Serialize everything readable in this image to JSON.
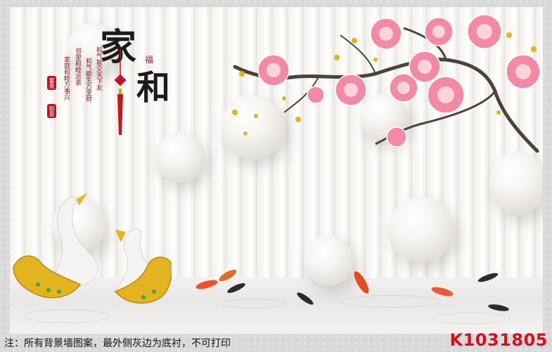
{
  "calligraphy": {
    "jia": "家",
    "he": "和",
    "fu": "福",
    "poem_lines": [
      "和气能交天下友",
      "和气能生万里财",
      "邻里和睦远亲",
      "家庭和睦万事兴"
    ],
    "seal_top": "富贵",
    "seal_bottom": "如意"
  },
  "caption": "注：所有背景墙图案，最外侧灰边为底衬，不可打印",
  "product_code": "K1031805",
  "icons": [
    "swan-icon",
    "koi-fish-icon",
    "magnolia-flower-icon",
    "chinese-knot-icon"
  ],
  "colors": {
    "background_stripe": "#f3f1ee",
    "code_red": "#d4121b",
    "seal_red": "#b8141f",
    "flower_pink": "#f28aa6",
    "gold": "#e3b320"
  }
}
